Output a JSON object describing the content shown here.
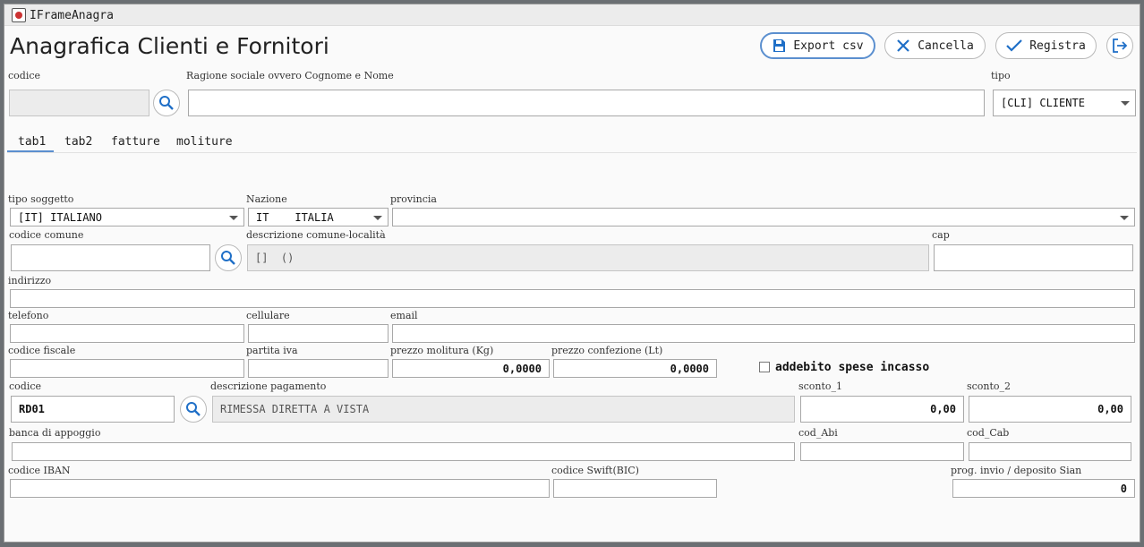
{
  "window": {
    "title": "IFrameAnagra"
  },
  "header": {
    "title": "Anagrafica Clienti e Fornitori",
    "export_label": "Export csv",
    "cancel_label": "Cancella",
    "save_label": "Registra"
  },
  "top": {
    "codice_label": "codice",
    "codice_value": "",
    "ragione_label": "Ragione sociale ovvero Cognome e Nome",
    "ragione_value": "",
    "tipo_label": "tipo",
    "tipo_value": "[CLI] CLIENTE"
  },
  "tabs": [
    "tab1",
    "tab2",
    "fatture",
    "moliture"
  ],
  "active_tab": "tab1",
  "form": {
    "tipo_soggetto_label": "tipo soggetto",
    "tipo_soggetto_value": "[IT] ITALIANO",
    "nazione_label": "Nazione",
    "nazione_value": "IT    ITALIA",
    "provincia_label": "provincia",
    "provincia_value": "",
    "codice_comune_label": "codice comune",
    "codice_comune_value": "",
    "descrizione_comune_label": "descrizione comune-località",
    "descrizione_comune_value": "[]  ()",
    "cap_label": "cap",
    "cap_value": "",
    "indirizzo_label": "indirizzo",
    "indirizzo_value": "",
    "telefono_label": "telefono",
    "telefono_value": "",
    "cellulare_label": "cellulare",
    "cellulare_value": "",
    "email_label": "email",
    "email_value": "",
    "codice_fiscale_label": "codice fiscale",
    "codice_fiscale_value": "",
    "partita_iva_label": "partita iva",
    "partita_iva_value": "",
    "prezzo_molitura_label": "prezzo molitura (Kg)",
    "prezzo_molitura_value": "0,0000",
    "prezzo_confezione_label": "prezzo confezione (Lt)",
    "prezzo_confezione_value": "0,0000",
    "addebito_label": "addebito spese incasso",
    "addebito_checked": false,
    "codice_pag_label": "codice",
    "codice_pag_value": "RD01",
    "descrizione_pag_label": "descrizione pagamento",
    "descrizione_pag_value": "RIMESSA DIRETTA A VISTA",
    "sconto1_label": "sconto_1",
    "sconto1_value": "0,00",
    "sconto2_label": "sconto_2",
    "sconto2_value": "0,00",
    "banca_label": "banca di appoggio",
    "banca_value": "",
    "cod_abi_label": "cod_Abi",
    "cod_abi_value": "",
    "cod_cab_label": "cod_Cab",
    "cod_cab_value": "",
    "iban_label": "codice IBAN",
    "iban_value": "",
    "swift_label": "codice Swift(BIC)",
    "swift_value": "",
    "prog_label": "prog. invio / deposito Sian",
    "prog_value": "0"
  },
  "colors": {
    "accent": "#1f6fc7",
    "focus_border": "#5b8fcf",
    "tab_underline": "#5b8fcf"
  },
  "icons": [
    "app-icon",
    "save-icon",
    "close-icon",
    "check-icon",
    "exit-icon",
    "search-icon",
    "dropdown-arrow-icon"
  ]
}
